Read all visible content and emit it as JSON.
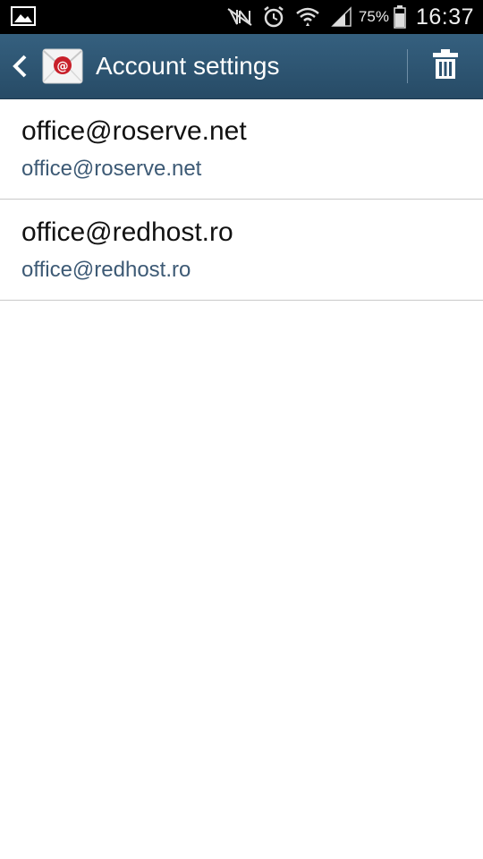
{
  "status_bar": {
    "icons": [
      "picture-notification-icon",
      "nfc-icon",
      "alarm-icon",
      "wifi-icon",
      "signal-icon",
      "battery-icon"
    ],
    "battery_percent": "75%",
    "time": "16:37"
  },
  "action_bar": {
    "title": "Account settings",
    "back_icon": "chevron-left-icon",
    "app_icon": "email-app-icon",
    "delete_icon": "trash-icon",
    "background_color": "#2e5573"
  },
  "accounts": [
    {
      "name": "office@roserve.net",
      "email": "office@roserve.net"
    },
    {
      "name": "office@redhost.ro",
      "email": "office@redhost.ro"
    }
  ],
  "colors": {
    "accent_text": "#3d5a75",
    "divider": "#c9c9c9"
  }
}
